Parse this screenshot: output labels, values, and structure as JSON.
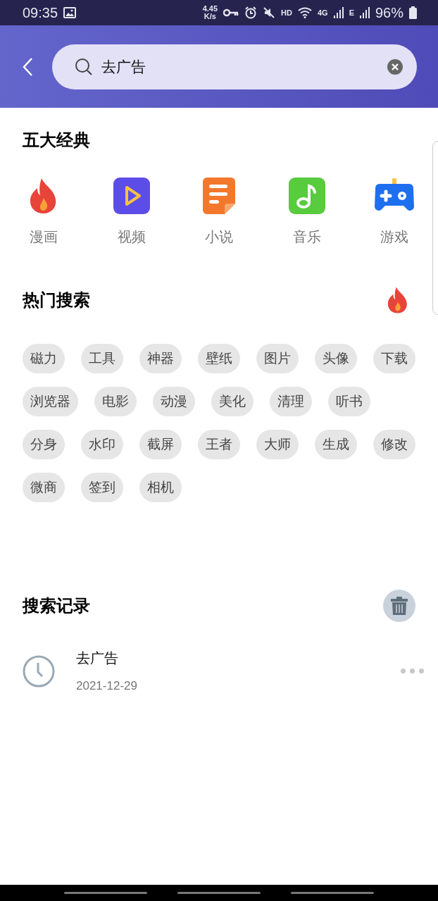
{
  "status_bar": {
    "time": "09:35",
    "speed": "4.45",
    "speed_unit": "K/s",
    "hd": "HD",
    "network": "4G",
    "network2": "E",
    "battery": "96%"
  },
  "search": {
    "value": "去广告"
  },
  "classics": {
    "title": "五大经典",
    "items": [
      {
        "label": "漫画",
        "kind": "flame"
      },
      {
        "label": "视频",
        "kind": "play"
      },
      {
        "label": "小说",
        "kind": "note"
      },
      {
        "label": "音乐",
        "kind": "music"
      },
      {
        "label": "游戏",
        "kind": "gamepad"
      }
    ]
  },
  "hot": {
    "title": "热门搜索",
    "rows": [
      [
        "磁力",
        "工具",
        "神器",
        "壁纸",
        "图片",
        "头像",
        "下载"
      ],
      [
        "浏览器",
        "电影",
        "动漫",
        "美化",
        "清理",
        "听书"
      ],
      [
        "分身",
        "水印",
        "截屏",
        "王者",
        "大师",
        "生成",
        "修改"
      ],
      [
        "微商",
        "签到",
        "相机"
      ]
    ]
  },
  "history": {
    "title": "搜索记录",
    "items": [
      {
        "query": "去广告",
        "date": "2021-12-29"
      }
    ]
  }
}
